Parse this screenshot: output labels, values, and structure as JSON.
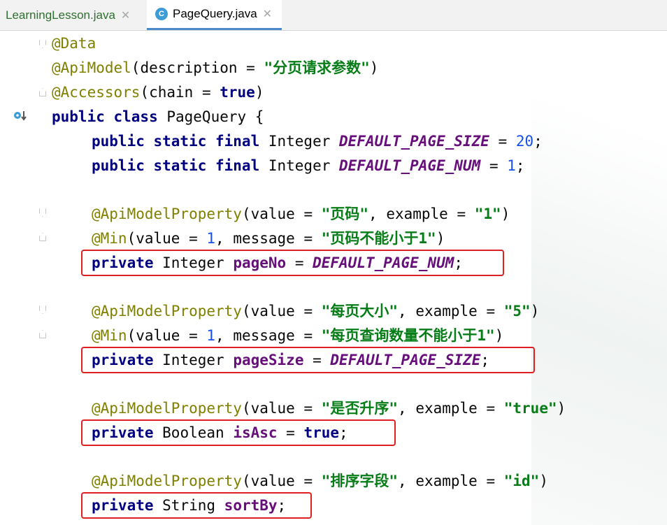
{
  "tabs": [
    {
      "label": "LearningLesson.java",
      "active": false
    },
    {
      "label": "PageQuery.java",
      "active": true,
      "icon": "class-icon",
      "icon_letter": "C"
    }
  ],
  "code": {
    "line1": "@Data",
    "line2_ann": "@ApiModel",
    "line2_mid": "(description = ",
    "line2_str": "\"分页请求参数\"",
    "line2_end": ")",
    "line3_ann": "@Accessors",
    "line3_mid": "(chain = ",
    "line3_kw": "true",
    "line3_end": ")",
    "line4_kw": "public class",
    "line4_rest": " PageQuery {",
    "line5_kw": "public static final",
    "line5_type": " Integer ",
    "line5_const": "DEFAULT_PAGE_SIZE",
    "line5_eq": " = ",
    "line5_num": "20",
    "line5_end": ";",
    "line6_kw": "public static final",
    "line6_type": " Integer ",
    "line6_const": "DEFAULT_PAGE_NUM",
    "line6_eq": " = ",
    "line6_num": "1",
    "line6_end": ";",
    "line7_ann": "@ApiModelProperty",
    "line7_a": "(value = ",
    "line7_s1": "\"页码\"",
    "line7_b": ", example = ",
    "line7_s2": "\"1\"",
    "line7_end": ")",
    "line8_ann": "@Min",
    "line8_a": "(value = ",
    "line8_num": "1",
    "line8_b": ", message = ",
    "line8_str": "\"页码不能小于1\"",
    "line8_end": ")",
    "line9_kw": "private",
    "line9_type": " Integer ",
    "line9_fld": "pageNo",
    "line9_eq": " = ",
    "line9_const": "DEFAULT_PAGE_NUM",
    "line9_end": ";",
    "line10_ann": "@ApiModelProperty",
    "line10_a": "(value = ",
    "line10_s1": "\"每页大小\"",
    "line10_b": ", example = ",
    "line10_s2": "\"5\"",
    "line10_end": ")",
    "line11_ann": "@Min",
    "line11_a": "(value = ",
    "line11_num": "1",
    "line11_b": ", message = ",
    "line11_str": "\"每页查询数量不能小于1\"",
    "line11_end": ")",
    "line12_kw": "private",
    "line12_type": " Integer ",
    "line12_fld": "pageSize",
    "line12_eq": " = ",
    "line12_const": "DEFAULT_PAGE_SIZE",
    "line12_end": ";",
    "line13_ann": "@ApiModelProperty",
    "line13_a": "(value = ",
    "line13_s1": "\"是否升序\"",
    "line13_b": ", example = ",
    "line13_s2": "\"true\"",
    "line13_end": ")",
    "line14_kw": "private",
    "line14_type": " Boolean ",
    "line14_fld": "isAsc",
    "line14_eq": " = ",
    "line14_kw2": "true",
    "line14_end": ";",
    "line15_ann": "@ApiModelProperty",
    "line15_a": "(value = ",
    "line15_s1": "\"排序字段\"",
    "line15_b": ", example = ",
    "line15_s2": "\"id\"",
    "line15_end": ")",
    "line16_kw": "private",
    "line16_type": " String ",
    "line16_fld": "sortBy",
    "line16_end": ";"
  },
  "colors": {
    "keyword": "#000080",
    "annotation": "#808000",
    "string": "#067d17",
    "number": "#1750eb",
    "constant": "#660e7a",
    "highlight_box": "#e02020"
  }
}
